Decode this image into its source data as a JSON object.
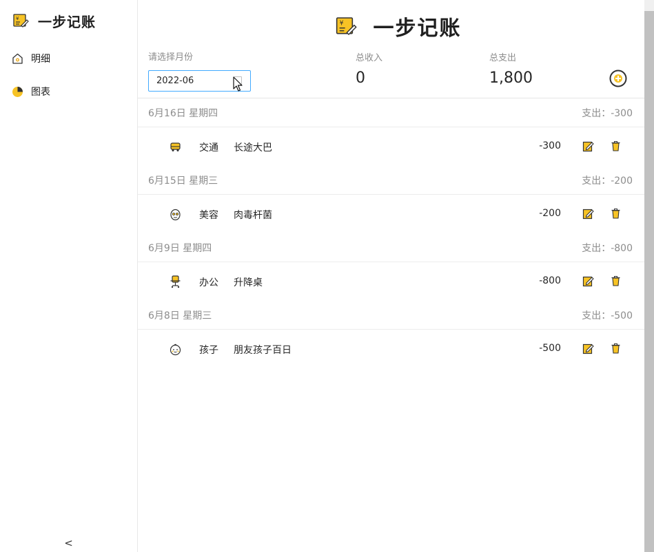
{
  "app": {
    "name": "一步记账",
    "icon": "ledger-note-icon"
  },
  "sidebar": {
    "items": [
      {
        "label": "明细",
        "icon": "home-icon"
      },
      {
        "label": "图表",
        "icon": "pie-chart-icon"
      }
    ],
    "collapse": "<"
  },
  "header": {
    "title": "一步记账"
  },
  "filter": {
    "month_label": "请选择月份",
    "month_value": "2022-06"
  },
  "summary": {
    "income_label": "总收入",
    "income_value": "0",
    "expense_label": "总支出",
    "expense_value": "1,800"
  },
  "days": [
    {
      "date": "6月16日 星期四",
      "total": "支出：-300",
      "records": [
        {
          "category": "交通",
          "note": "长途大巴",
          "amount": "-300",
          "icon": "bus-icon"
        }
      ]
    },
    {
      "date": "6月15日 星期三",
      "total": "支出：-200",
      "records": [
        {
          "category": "美容",
          "note": "肉毒杆菌",
          "amount": "-200",
          "icon": "face-beauty-icon"
        }
      ]
    },
    {
      "date": "6月9日 星期四",
      "total": "支出：-800",
      "records": [
        {
          "category": "办公",
          "note": "升降桌",
          "amount": "-800",
          "icon": "office-chair-icon"
        }
      ]
    },
    {
      "date": "6月8日 星期三",
      "total": "支出：-500",
      "records": [
        {
          "category": "孩子",
          "note": "朋友孩子百日",
          "amount": "-500",
          "icon": "baby-face-icon"
        }
      ]
    }
  ],
  "colors": {
    "accent_yellow": "#f7c325",
    "picker_border": "#40a9ff",
    "muted_text": "#8c8c8c"
  }
}
